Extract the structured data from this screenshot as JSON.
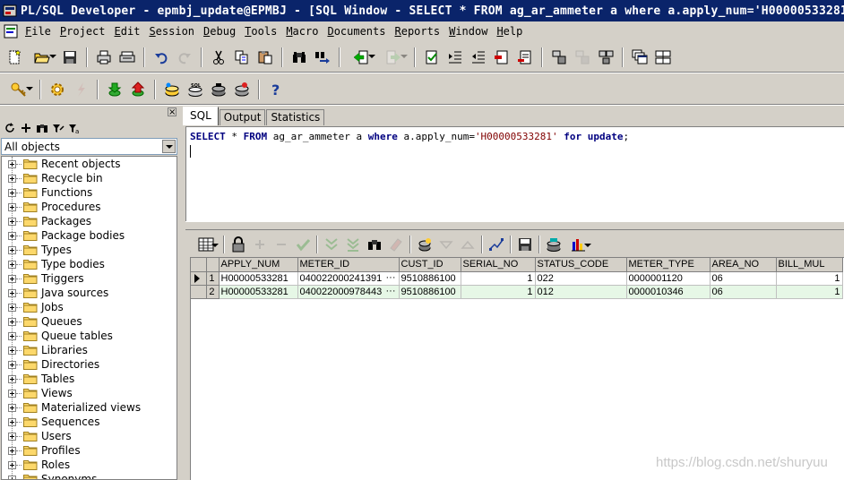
{
  "window": {
    "title": "PL/SQL Developer - epmbj_update@EPMBJ - [SQL Window - SELECT * FROM ag_ar_ammeter a where a.apply_num='H00000533281"
  },
  "menu": [
    "File",
    "Project",
    "Edit",
    "Session",
    "Debug",
    "Tools",
    "Macro",
    "Documents",
    "Reports",
    "Window",
    "Help"
  ],
  "left_pane": {
    "close_glyph": "×",
    "object_selector": "All objects",
    "tree_items": [
      "Recent objects",
      "Recycle bin",
      "Functions",
      "Procedures",
      "Packages",
      "Package bodies",
      "Types",
      "Type bodies",
      "Triggers",
      "Java sources",
      "Jobs",
      "Queues",
      "Queue tables",
      "Libraries",
      "Directories",
      "Tables",
      "Views",
      "Materialized views",
      "Sequences",
      "Users",
      "Profiles",
      "Roles",
      "Synonyms"
    ]
  },
  "tabs": [
    "SQL",
    "Output",
    "Statistics"
  ],
  "editor": {
    "sql": {
      "kw1": "SELECT",
      "t1": " * ",
      "kw2": "FROM",
      "t2": " ag_ar_ammeter a ",
      "kw3": "where",
      "t3": " a.apply_num=",
      "str": "'H00000533281'",
      "t4": " ",
      "kw4": "for",
      "t5": " ",
      "kw5": "update",
      "t6": ";"
    }
  },
  "grid": {
    "columns": [
      "APPLY_NUM",
      "METER_ID",
      "CUST_ID",
      "SERIAL_NO",
      "STATUS_CODE",
      "METER_TYPE",
      "AREA_NO",
      "BILL_MUL"
    ],
    "rows": [
      {
        "num": "1",
        "cells": [
          "H00000533281",
          "040022000241391",
          "9510886100",
          "1",
          "022",
          "0000001120",
          "06",
          "1"
        ]
      },
      {
        "num": "2",
        "cells": [
          "H00000533281",
          "040022000978443",
          "9510886100",
          "1",
          "012",
          "0000010346",
          "06",
          "1"
        ]
      }
    ],
    "ellipsis": "···"
  },
  "watermark": "https://blog.csdn.net/shuryuu",
  "colors": {
    "titlebar": "#0a246a",
    "face": "#d4d0c8",
    "keyword": "#000080",
    "string": "#800000",
    "selected_row": "#e6f7e6"
  }
}
